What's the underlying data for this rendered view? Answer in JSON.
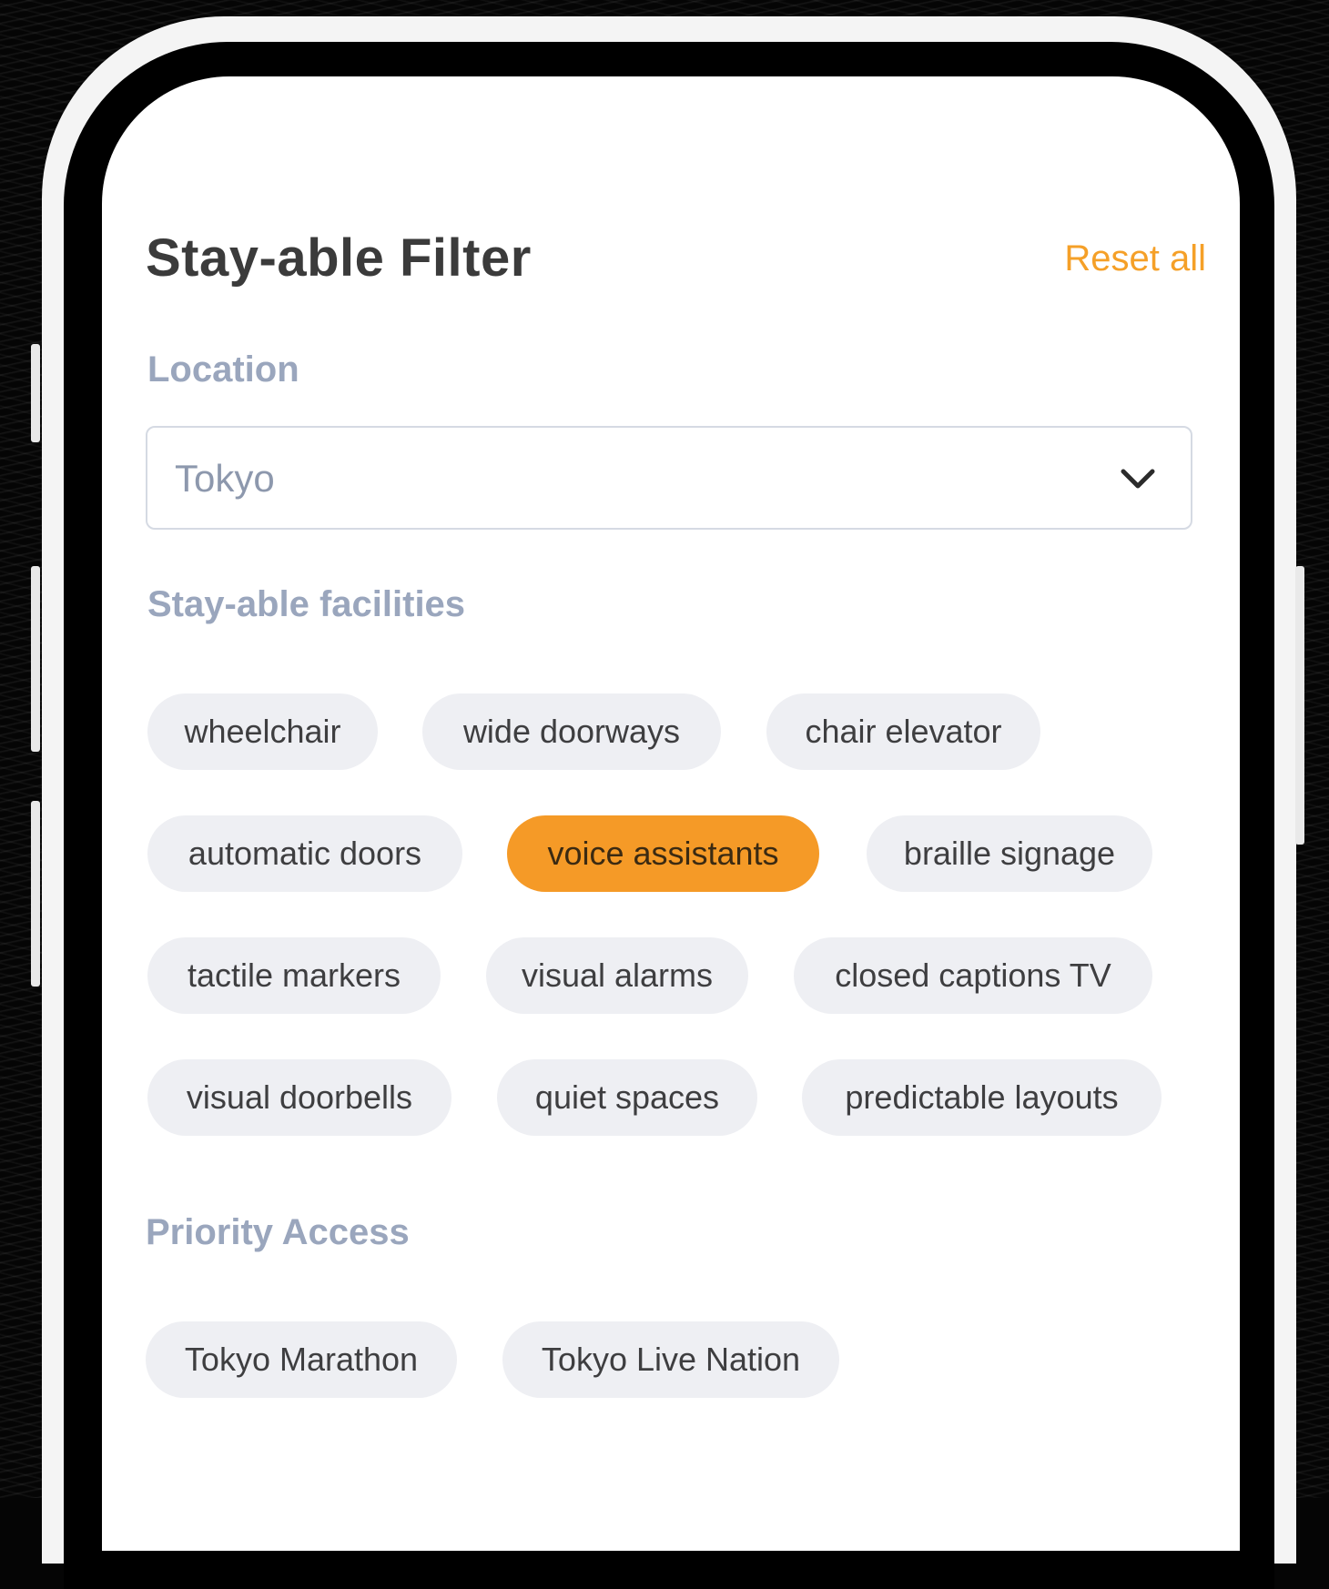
{
  "header": {
    "title": "Stay-able Filter",
    "reset_label": "Reset all"
  },
  "location": {
    "label": "Location",
    "value": "Tokyo"
  },
  "facilities": {
    "label": "Stay-able facilities",
    "chips": [
      {
        "label": "wheelchair",
        "selected": false
      },
      {
        "label": "wide doorways",
        "selected": false
      },
      {
        "label": "chair elevator",
        "selected": false
      },
      {
        "label": "automatic doors",
        "selected": false
      },
      {
        "label": "voice assistants",
        "selected": true
      },
      {
        "label": "braille signage",
        "selected": false
      },
      {
        "label": "tactile markers",
        "selected": false
      },
      {
        "label": "visual alarms",
        "selected": false
      },
      {
        "label": "closed captions TV",
        "selected": false
      },
      {
        "label": "visual doorbells",
        "selected": false
      },
      {
        "label": "quiet spaces",
        "selected": false
      },
      {
        "label": "predictable layouts",
        "selected": false
      }
    ]
  },
  "priority_access": {
    "label": "Priority Access",
    "chips": [
      {
        "label": "Tokyo Marathon",
        "selected": false
      },
      {
        "label": "Tokyo Live Nation",
        "selected": false
      }
    ]
  },
  "colors": {
    "accent": "#f59a27",
    "chip_bg": "#eeeff3",
    "section_label": "#9aa6bd",
    "title": "#3b3b3b"
  },
  "icons": {
    "dropdown": "chevron-down-icon"
  }
}
